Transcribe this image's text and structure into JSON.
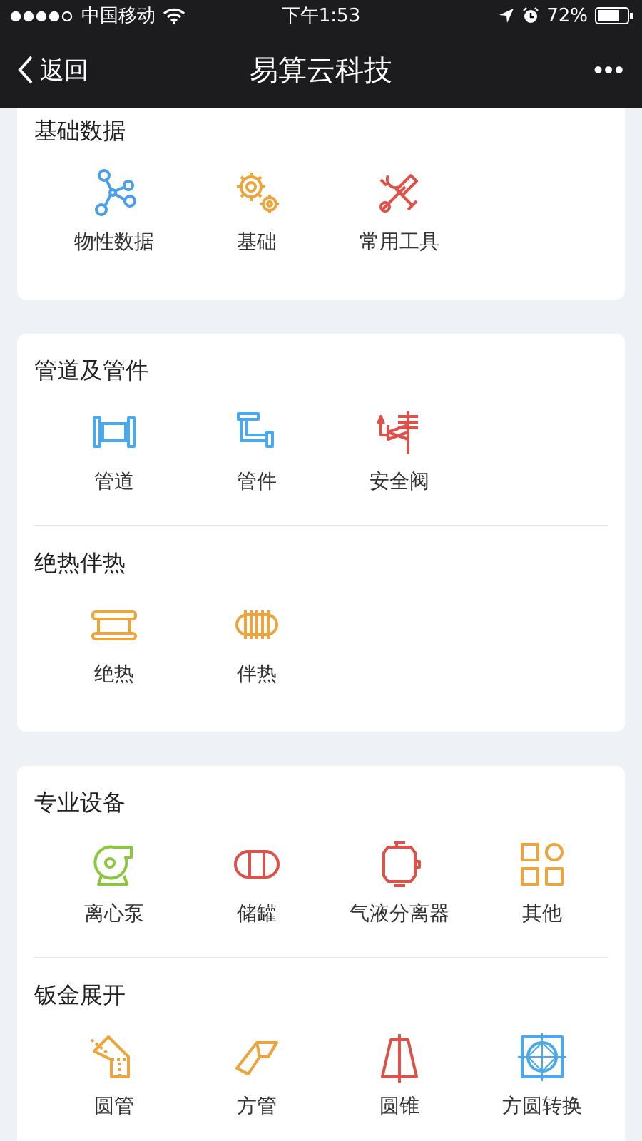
{
  "status_bar": {
    "carrier": "中国移动",
    "time": "下午1:53",
    "battery": "72%"
  },
  "nav_bar": {
    "back": "返回",
    "title": "易算云科技",
    "more": "•••"
  },
  "cards": [
    {
      "groups": [
        {
          "title": "基础数据",
          "items": [
            {
              "label": "物性数据",
              "kind": "network",
              "color": "#4a9fe8"
            },
            {
              "label": "基础",
              "kind": "gears",
              "color": "#eba53c"
            },
            {
              "label": "常用工具",
              "kind": "tools",
              "color": "#dc5248"
            }
          ]
        }
      ]
    },
    {
      "groups": [
        {
          "title": "管道及管件",
          "items": [
            {
              "label": "管道",
              "kind": "pipe",
              "color": "#4aa8ec"
            },
            {
              "label": "管件",
              "kind": "fitting",
              "color": "#4aa8ec"
            },
            {
              "label": "安全阀",
              "kind": "valve",
              "color": "#dc5248"
            }
          ]
        },
        {
          "title": "绝热伴热",
          "items": [
            {
              "label": "绝热",
              "kind": "insulation",
              "color": "#eba53c"
            },
            {
              "label": "伴热",
              "kind": "tracing",
              "color": "#eba53c"
            }
          ]
        }
      ]
    },
    {
      "groups": [
        {
          "title": "专业设备",
          "items": [
            {
              "label": "离心泵",
              "kind": "pump",
              "color": "#8cc63f"
            },
            {
              "label": "储罐",
              "kind": "tank",
              "color": "#dc5248"
            },
            {
              "label": "气液分离器",
              "kind": "separator",
              "color": "#dc5248"
            },
            {
              "label": "其他",
              "kind": "other",
              "color": "#eba53c"
            }
          ]
        },
        {
          "title": "钣金展开",
          "items": [
            {
              "label": "圆管",
              "kind": "roundpipe",
              "color": "#eba53c"
            },
            {
              "label": "方管",
              "kind": "squarepipe",
              "color": "#eba53c"
            },
            {
              "label": "圆锥",
              "kind": "cone",
              "color": "#dc5248"
            },
            {
              "label": "方圆转换",
              "kind": "transition",
              "color": "#4aa8ec"
            }
          ]
        }
      ]
    }
  ]
}
